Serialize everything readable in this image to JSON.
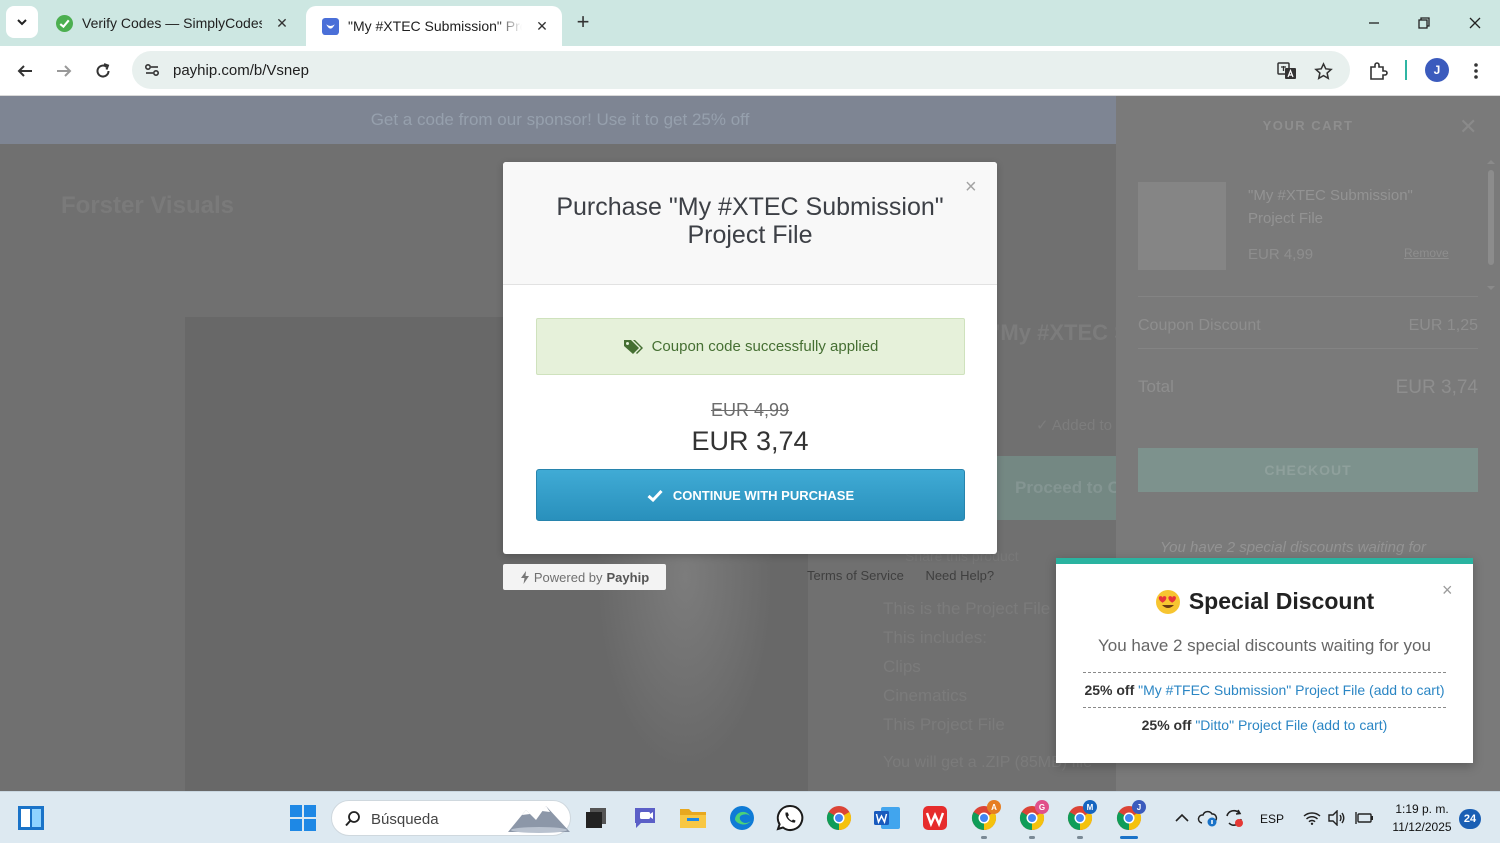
{
  "browser": {
    "tabs": [
      {
        "title": "Verify Codes — SimplyCodes",
        "active": false
      },
      {
        "title": "\"My #XTEC Submission\" Project File",
        "active": true
      }
    ],
    "url": "payhip.com/b/Vsnep",
    "profile_initial": "J"
  },
  "page": {
    "announcement": "Get a code from our sponsor! Use it to get 25% off",
    "store_name": "Forster Visuals",
    "product_title": "\"My #XTEC Submission\" Project File",
    "added_to_cart": "✓  Added to cart",
    "proceed_label": "Proceed to Checkout",
    "share_label": "Share this product",
    "links": {
      "terms": "Terms of Service",
      "help": "Need Help?"
    },
    "description": [
      "This is the Project File",
      "This includes:",
      "Clips",
      "Cinematics",
      "This Project File"
    ],
    "footer_text": "You will get a .ZIP (85MB) file"
  },
  "cart": {
    "title": "YOUR CART",
    "item_name": "\"My #XTEC Submission\" Project File",
    "item_price": "EUR 4,99",
    "remove_label": "Remove",
    "coupon_label": "Coupon Discount",
    "coupon_value": "EUR 1,25",
    "total_label": "Total",
    "total_value": "EUR 3,74",
    "checkout_label": "CHECKOUT",
    "note": "You have 2 special discounts waiting for"
  },
  "modal": {
    "title_line1": "Purchase \"My #XTEC Submission\"",
    "title_line2": "Project File",
    "close": "×",
    "coupon_message": "Coupon code successfully applied",
    "old_price": "EUR 4,99",
    "new_price": "EUR 3,74",
    "continue_label": "CONTINUE WITH PURCHASE",
    "powered_prefix": "Powered by",
    "powered_brand": "Payhip"
  },
  "special": {
    "title": "Special Discount",
    "subtitle": "You have 2 special discounts waiting for you",
    "close": "×",
    "offers": [
      {
        "pct": "25% off",
        "link": "\"My #TFEC Submission\" Project File (add to cart)"
      },
      {
        "pct": "25% off",
        "link": "\"Ditto\" Project File (add to cart)"
      }
    ]
  },
  "taskbar": {
    "search_placeholder": "Búsqueda",
    "language": "ESP",
    "time": "1:19 p. m.",
    "date": "11/12/2025",
    "notifications": "24"
  },
  "colors": {
    "accent_teal": "#2ab3a0",
    "button_blue": "#2990bc",
    "success_green": "#456f32",
    "link_blue": "#2b86c4"
  }
}
